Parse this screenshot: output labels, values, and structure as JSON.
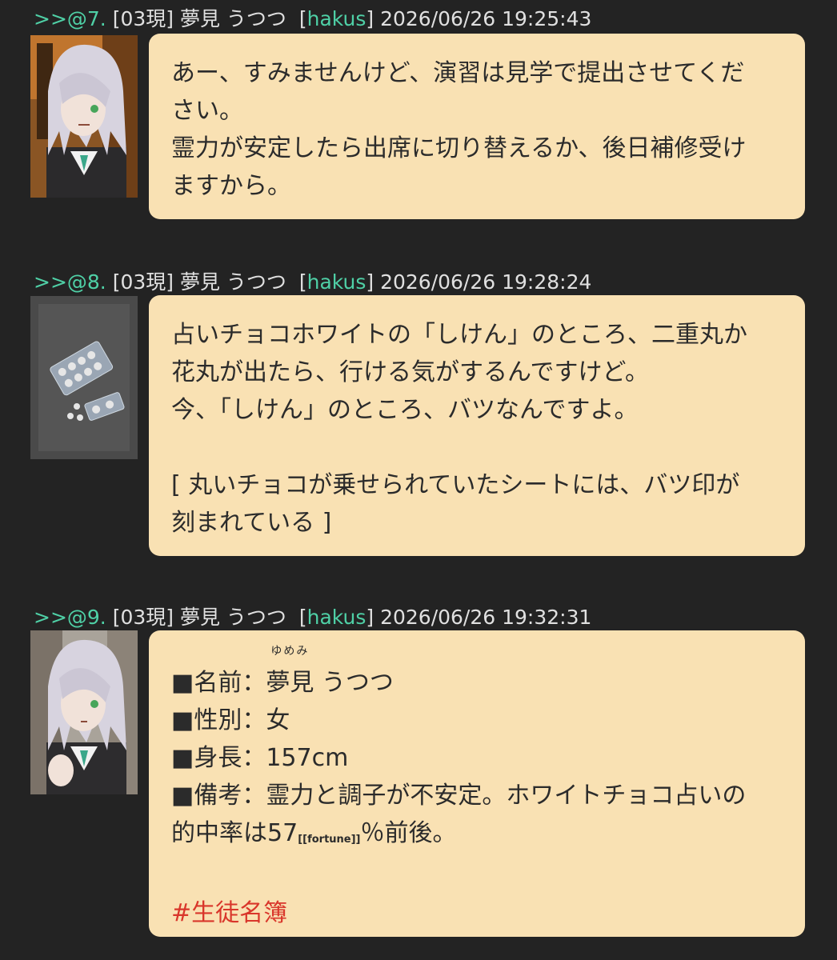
{
  "posts": [
    {
      "number": ">>@7.",
      "room": "[03現]",
      "name": "夢見 うつつ",
      "trip_open": "[",
      "trip": "hakus",
      "trip_close": "]",
      "timestamp": "2026/06/26 19:25:43",
      "lines": [
        "あー、すみませんけど、演習は見学で提出させてくだ",
        "さい。",
        "霊力が安定したら出席に切り替えるか、後日補修受け",
        "ますから。"
      ]
    },
    {
      "number": ">>@8.",
      "room": "[03現]",
      "name": "夢見 うつつ",
      "trip_open": "[",
      "trip": "hakus",
      "trip_close": "]",
      "timestamp": "2026/06/26 19:28:24",
      "lines": [
        "占いチョコホワイトの「しけん」のところ、二重丸か",
        "花丸が出たら、行ける気がするんですけど。",
        "今、「しけん」のところ、バツなんですよ。",
        "",
        "[ 丸いチョコが乗せられていたシートには、バツ印が",
        "刻まれている ]"
      ]
    },
    {
      "number": ">>@9.",
      "room": "[03現]",
      "name": "夢見 うつつ",
      "trip_open": "[",
      "trip": "hakus",
      "trip_close": "]",
      "timestamp": "2026/06/26 19:32:31",
      "profile": {
        "name_prefix": "■名前：",
        "name_kanji": "夢見",
        "name_ruby": "ゆめみ",
        "name_rest": " うつつ",
        "gender": "■性別：女",
        "height": "■身長：157cm",
        "notes_line1": "■備考：霊力と調子が不安定。ホワイトチョコ占いの",
        "notes_line2_a": "的中率は57",
        "notes_line2_small": "[[fortune]]",
        "notes_line2_b": "％前後。",
        "hashtag": "#生徒名簿"
      }
    }
  ],
  "colors": {
    "background": "#232323",
    "bubble": "#f9e1b3",
    "accent": "#4fd0a6",
    "hashtag": "#d9362b"
  }
}
